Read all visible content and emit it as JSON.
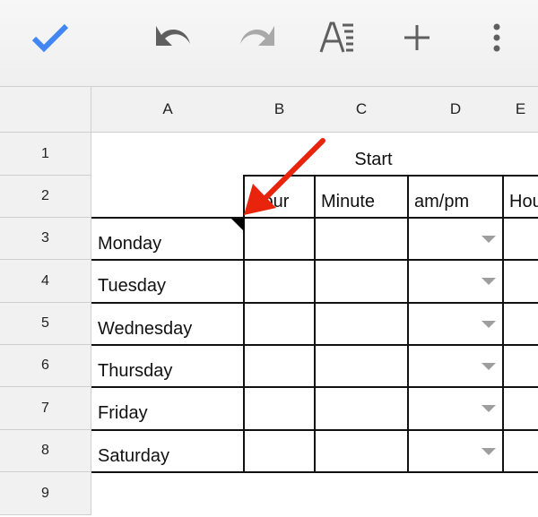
{
  "toolbar": {
    "icons": [
      "check-icon",
      "undo-icon",
      "redo-icon",
      "text-format-icon",
      "plus-icon",
      "more-vert-icon"
    ],
    "accent": "#4285f4"
  },
  "columns": [
    "A",
    "B",
    "C",
    "D",
    "E"
  ],
  "rows": [
    "1",
    "2",
    "3",
    "4",
    "5",
    "6",
    "7",
    "8",
    "9"
  ],
  "cells": {
    "start_label": "Start",
    "headers": [
      "Hour",
      "Minute",
      "am/pm",
      "Hour"
    ],
    "days": [
      "Monday",
      "Tuesday",
      "Wednesday",
      "Thursday",
      "Friday",
      "Saturday"
    ]
  },
  "annotation": {
    "arrow_color": "#e8250c"
  }
}
